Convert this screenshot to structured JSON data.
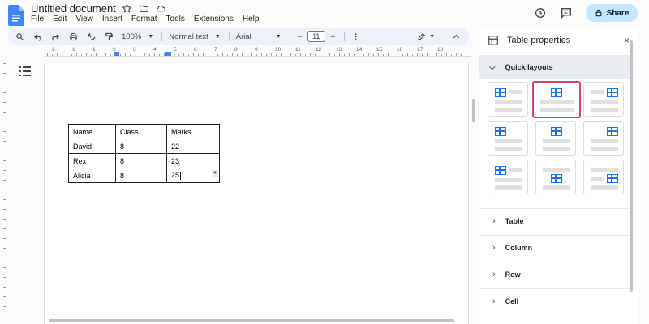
{
  "app": {
    "doc_title": "Untitled document",
    "menu": [
      "File",
      "Edit",
      "View",
      "Insert",
      "Format",
      "Tools",
      "Extensions",
      "Help"
    ],
    "share_label": "Share",
    "brand_color": "#4285f4"
  },
  "toolbar": {
    "zoom": "100%",
    "style": "Normal text",
    "font": "Arial",
    "font_size": "11",
    "minus": "−",
    "plus": "+"
  },
  "ruler": {
    "numbers": [
      "2",
      "1",
      "1",
      "2",
      "3",
      "4",
      "5",
      "6",
      "7",
      "8",
      "9",
      "10",
      "11",
      "12",
      "13",
      "14",
      "15",
      "16",
      "17",
      "18"
    ]
  },
  "table": {
    "rows": [
      [
        "Name",
        "Class",
        "Marks"
      ],
      [
        "David",
        "8",
        "22"
      ],
      [
        "Rex",
        "8",
        "23"
      ],
      [
        "Alicia",
        "8",
        "25"
      ]
    ]
  },
  "panel": {
    "title": "Table properties",
    "close": "×",
    "quick_layouts": "Quick layouts",
    "sections": [
      "Table",
      "Column",
      "Row",
      "Cell"
    ],
    "selected_color": "#d23f71",
    "accent_color": "#1a73e8"
  },
  "icons": {
    "outline": "outline-list-icon",
    "history": "history-icon",
    "comments": "comment-icon",
    "lock": "lock-icon"
  }
}
